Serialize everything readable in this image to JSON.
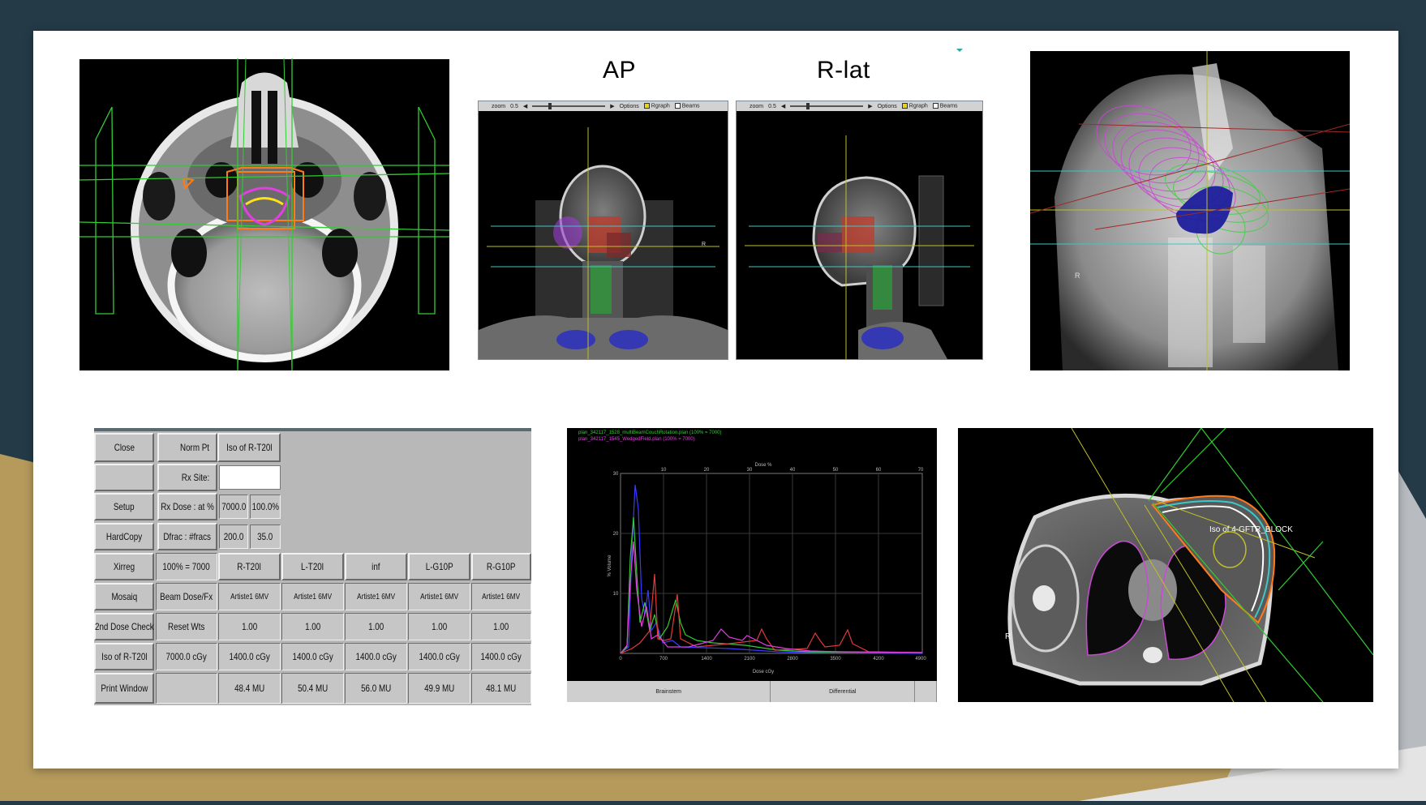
{
  "colors": {
    "background_dark": "#243b47",
    "accent_gold": "#b59a5c",
    "slide_white": "#ffffff",
    "contour_green": "#33cc33",
    "contour_magenta": "#e23ee2",
    "contour_orange": "#ff7b1a",
    "contour_yellow": "#ffe11a",
    "crosshair_yellow": "#bfbf2a"
  },
  "views": {
    "ap_title": "AP",
    "rlat_title": "R-lat",
    "ap_marker": "R",
    "rendering_marker": "R",
    "breast_marker": "R",
    "breast_iso_label": "Iso of 4-GFTR_BLOCK"
  },
  "drr_toolbar": {
    "zoom_label": "zoom",
    "zoom_value": "0.5",
    "options_label": "Options",
    "rgraph_label": "Rgraph",
    "beams_label": "Beams"
  },
  "dose_panel": {
    "buttons": {
      "close": "Close",
      "setup": "Setup",
      "hardcopy": "HardCopy",
      "xirreg": "Xirreg",
      "mosaiq": "Mosaiq",
      "second_dose_check": "2nd Dose Check",
      "iso": "Iso of R-T20l",
      "print_window": "Print Window"
    },
    "norm_pt_label": "Norm Pt",
    "norm_pt_value": "Iso of R-T20l",
    "rx_site_label": "Rx Site:",
    "rx_site_value": "",
    "rx_dose_label": "Rx Dose : at %",
    "rx_dose_value": "7000.0",
    "rx_dose_pct": "100.0%",
    "dfrac_label": "Dfrac : #fracs",
    "dfrac_value": "200.0",
    "fracs_value": "35.0",
    "row_labels": {
      "header": "100% = 7000",
      "machine": "Beam Dose/Fx",
      "weights": "Reset Wts",
      "dose": "7000.0 cGy"
    },
    "beams": [
      {
        "name": "R-T20l",
        "machine": "Artiste1 6MV",
        "weight": "1.00",
        "dose": "1400.0 cGy",
        "mu": "48.4 MU"
      },
      {
        "name": "L-T20l",
        "machine": "Artiste1 6MV",
        "weight": "1.00",
        "dose": "1400.0 cGy",
        "mu": "50.4 MU"
      },
      {
        "name": "inf",
        "machine": "Artiste1 6MV",
        "weight": "1.00",
        "dose": "1400.0 cGy",
        "mu": "56.0 MU"
      },
      {
        "name": "L-G10P",
        "machine": "Artiste1 6MV",
        "weight": "1.00",
        "dose": "1400.0 cGy",
        "mu": "49.9 MU"
      },
      {
        "name": "R-G10P",
        "machine": "Artiste1 6MV",
        "weight": "1.00",
        "dose": "1400.0 cGy",
        "mu": "48.1 MU"
      }
    ]
  },
  "dvh": {
    "top_axis_label": "Dose %",
    "bottom_axis_label": "Dose cGy",
    "y_axis_label": "% Volume",
    "top_ticks": [
      "10",
      "20",
      "30",
      "40",
      "50",
      "60",
      "70"
    ],
    "bottom_ticks": [
      "0",
      "700",
      "1400",
      "2100",
      "2800",
      "3500",
      "4200",
      "4900"
    ],
    "left_ticks": [
      "30",
      "20",
      "10"
    ],
    "legend": [
      {
        "text": "plan_342117_1528_multiBeamCouchRotation.plan (100% = 7000)",
        "color": "#33cc33"
      },
      {
        "text": "plan_342117_1545_WedgedField.plan (100% = 7000)",
        "color": "#e23ee2"
      }
    ],
    "bottom_tabs": [
      "Brainstem",
      "Differential"
    ]
  }
}
